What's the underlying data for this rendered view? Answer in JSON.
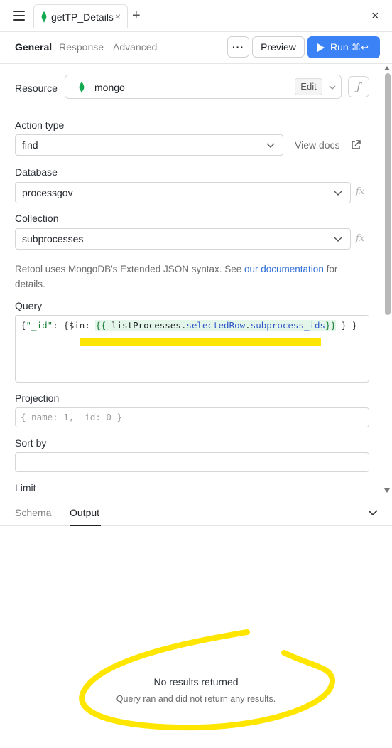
{
  "tab": {
    "title": "getTP_Details",
    "close": "×"
  },
  "new_tab": "+",
  "window_close": "×",
  "subtabs": {
    "general": "General",
    "response": "Response",
    "advanced": "Advanced"
  },
  "toolbar": {
    "more": "···",
    "preview": "Preview",
    "run": "Run",
    "run_shortcut": "⌘↩"
  },
  "resource": {
    "label": "Resource",
    "value": "mongo",
    "edit": "Edit",
    "fx": "ƒ"
  },
  "action_type": {
    "label": "Action type",
    "value": "find",
    "view_docs": "View docs"
  },
  "database": {
    "label": "Database",
    "value": "processgov",
    "fx": "fx"
  },
  "collection": {
    "label": "Collection",
    "value": "subprocesses",
    "fx": "fx"
  },
  "help": {
    "prefix": "Retool uses MongoDB's Extended JSON syntax. See ",
    "link": "our documentation",
    "suffix": " for",
    "line2": "details."
  },
  "query": {
    "label": "Query",
    "part1": "{",
    "key": "\"_id\"",
    "part2": ": {$in: ",
    "open": "{{",
    "obj": "listProcesses",
    "dot1": ".",
    "prop1": "selectedRow",
    "dot2": ".",
    "prop2": "subprocess_ids",
    "close": "}}",
    "part3": " } }"
  },
  "projection": {
    "label": "Projection",
    "placeholder": "{ name: 1, _id: 0 }"
  },
  "sort_by": {
    "label": "Sort by",
    "value": ""
  },
  "limit": {
    "label": "Limit"
  },
  "bottom_tabs": {
    "schema": "Schema",
    "output": "Output"
  },
  "output": {
    "title": "No results returned",
    "subtitle": "Query ran and did not return any results."
  },
  "colors": {
    "accent": "#3b82f6",
    "mongo_green": "#13aa52",
    "highlight": "#ffe600"
  },
  "icons": [
    "menu-icon",
    "mongo-leaf-icon",
    "close-icon",
    "plus-icon",
    "play-icon",
    "chevron-down-icon",
    "external-link-icon",
    "fx-icon"
  ]
}
